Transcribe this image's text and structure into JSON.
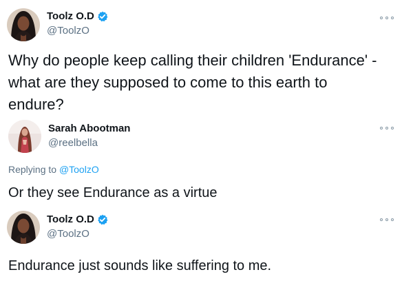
{
  "tweet1": {
    "author": {
      "name": "Toolz O.D",
      "handle": "@ToolzO",
      "verified": true,
      "avatar_icon": "profile-photo-icon"
    },
    "text_lines": [
      "Why do people keep calling their children 'Endurance' -",
      "what are they supposed to come to this earth to",
      "endure?"
    ]
  },
  "tweet2": {
    "author": {
      "name": "Sarah Abootman",
      "handle": "@reelbella",
      "verified": false,
      "avatar_icon": "profile-photo-icon"
    },
    "replying_prefix": "Replying to",
    "replying_handle": "@ToolzO",
    "text": "Or they see Endurance as a virtue"
  },
  "tweet3": {
    "author": {
      "name": "Toolz O.D",
      "handle": "@ToolzO",
      "verified": true,
      "avatar_icon": "profile-photo-icon"
    },
    "text": "Endurance just sounds like suffering to me."
  },
  "colors": {
    "text_primary": "#0f1419",
    "text_secondary": "#5b7083",
    "link": "#1da1f2",
    "verified_badge": "#1da1f2"
  },
  "icons": {
    "verified": "verified-badge-icon",
    "more": "more-options-icon"
  }
}
